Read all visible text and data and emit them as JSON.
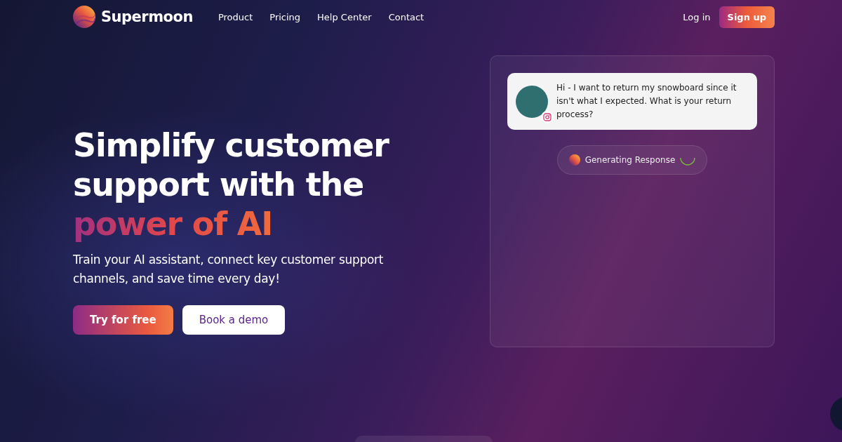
{
  "nav": {
    "brand": "Supermoon",
    "links": [
      "Product",
      "Pricing",
      "Help Center",
      "Contact"
    ],
    "login": "Log in",
    "signup": "Sign up"
  },
  "hero": {
    "headline": [
      {
        "text": "Simplify customer",
        "kind": "plain"
      },
      {
        "text": "support with the",
        "kind": "plain"
      },
      {
        "text": "power of AI",
        "kind": "gradient"
      }
    ],
    "subtitle": "Train your AI assistant, connect key customer support channels, and save time every day!",
    "buttons": [
      {
        "label": "Try for free",
        "kind": "primary"
      },
      {
        "label": "Book a demo",
        "kind": "secondary"
      }
    ]
  },
  "chat": {
    "message": "Hi - I want to return my snowboard since it isn't what I expected. What is your return process?",
    "status": "Generating Response"
  }
}
